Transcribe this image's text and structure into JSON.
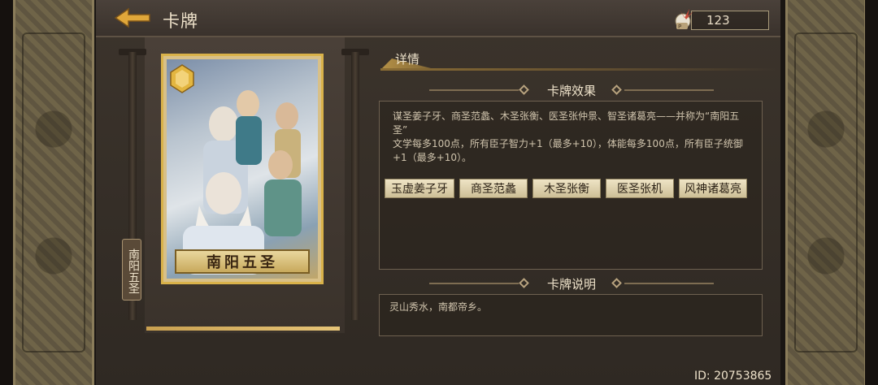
{
  "header": {
    "title": "卡牌",
    "currency_value": "123"
  },
  "card": {
    "name": "南阳五圣",
    "vertical_label": "南阳五圣",
    "badge_icon": "card-quality-badge",
    "progress": 1.0
  },
  "details": {
    "tab_label": "详情",
    "effect": {
      "title": "卡牌效果",
      "text_line1": "谋圣姜子牙、商圣范蠡、木圣张衡、医圣张仲景、智圣诸葛亮——并称为“南阳五圣”",
      "text_line2": "文学每多100点，所有臣子智力+1（最多+10），体能每多100点，所有臣子统御+1（最多+10）。",
      "members": [
        "玉虚姜子牙",
        "商圣范蠡",
        "木圣张衡",
        "医圣张机",
        "风神诸葛亮"
      ]
    },
    "description": {
      "title": "卡牌说明",
      "text": "灵山秀水，南都帝乡。"
    }
  },
  "footer": {
    "user_id": "ID: 20753865"
  },
  "colors": {
    "accent_gold": "#d9b24a",
    "panel_bg": "#3c342c",
    "text": "#e8dcc6"
  }
}
